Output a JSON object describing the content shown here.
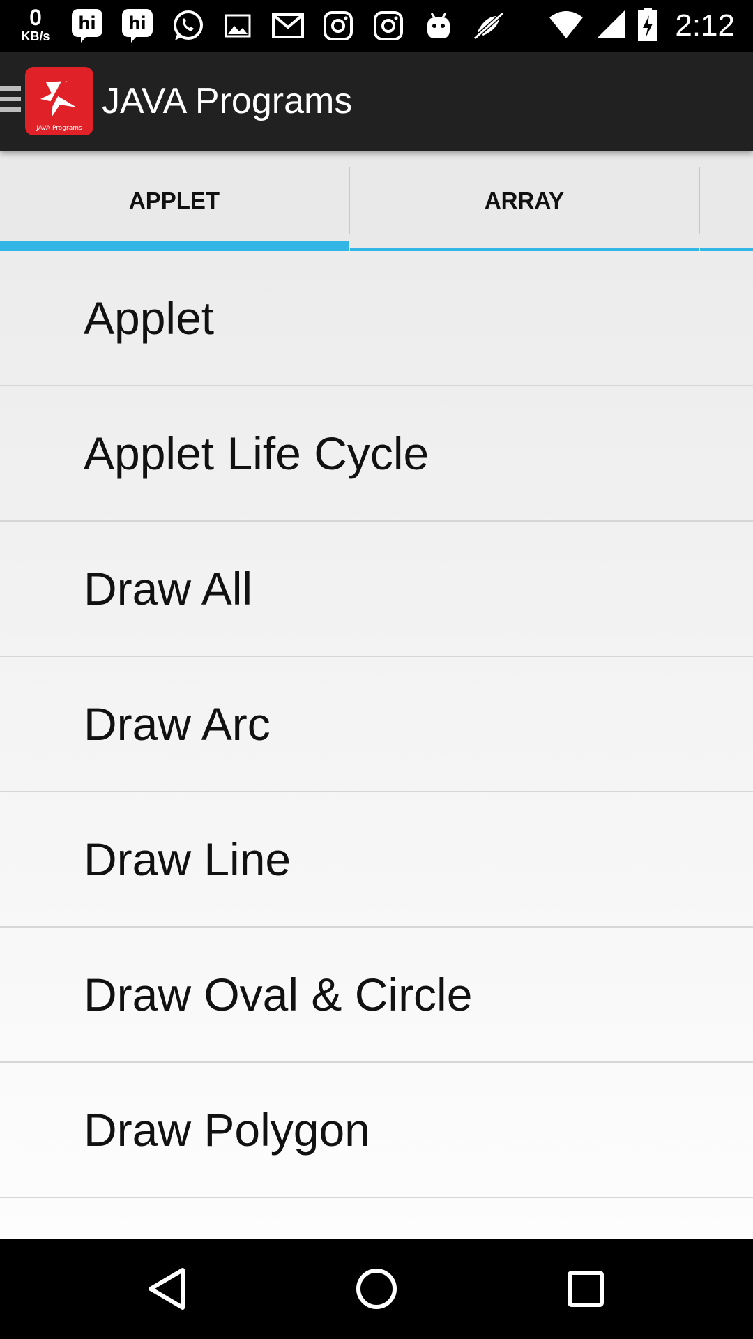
{
  "status_bar": {
    "speed_value": "0",
    "speed_unit": "KB/s",
    "time": "2:12",
    "notification_icons": [
      "hike-icon",
      "hike-icon",
      "whatsapp-icon",
      "image-icon",
      "gmail-icon",
      "instagram-icon",
      "instagram-icon",
      "android-icon",
      "no-data-icon"
    ],
    "system_icons": [
      "wifi-icon",
      "signal-icon",
      "battery-charging-icon"
    ]
  },
  "app_bar": {
    "title": "JAVA Programs",
    "logo_caption": "JAVA Programs",
    "accent": "#e02128"
  },
  "tabs": [
    {
      "label": "APPLET",
      "selected": true
    },
    {
      "label": "ARRAY",
      "selected": false
    }
  ],
  "tab_indicator_color": "#33b5e5",
  "list": {
    "items": [
      "Applet",
      "Applet Life Cycle",
      "Draw All",
      "Draw Arc",
      "Draw Line",
      "Draw Oval & Circle",
      "Draw Polygon"
    ]
  },
  "nav_bar": {
    "buttons": [
      "back-icon",
      "home-icon",
      "recents-icon"
    ]
  }
}
